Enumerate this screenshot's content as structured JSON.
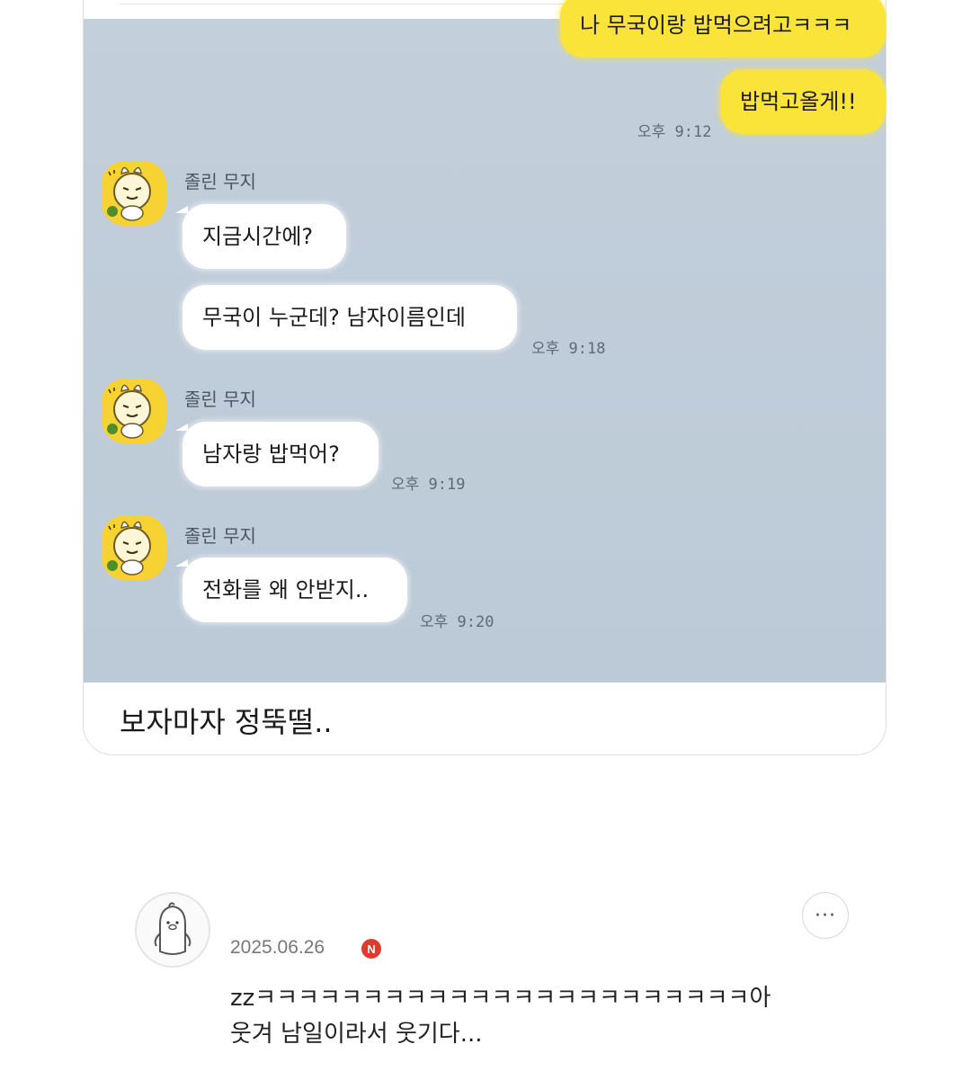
{
  "chat": {
    "messages_me": [
      {
        "text": "나 무국이랑 밥먹으려고ㅋㅋㅋ"
      },
      {
        "text": "밥먹고올게!!",
        "time": "오후 9:12"
      }
    ],
    "groups": [
      {
        "sender": "졸린 무지",
        "messages": [
          {
            "text": "지금시간에?"
          },
          {
            "text": "무국이 누군데? 남자이름인데",
            "time": "오후 9:18"
          }
        ]
      },
      {
        "sender": "졸린 무지",
        "messages": [
          {
            "text": "남자랑 밥먹어?",
            "time": "오후 9:19"
          }
        ]
      },
      {
        "sender": "졸린 무지",
        "messages": [
          {
            "text": "전화를 왜 안받지..",
            "time": "오후 9:20"
          }
        ]
      }
    ]
  },
  "caption": "보자마자 정뚝떨..",
  "comment": {
    "date": "2025.06.26",
    "badge": "N",
    "more": "···",
    "line1": "zzㅋㅋㅋㅋㅋㅋㅋㅋㅋㅋㅋㅋㅋㅋㅋㅋㅋㅋㅋㅋㅋㅋㅋ아",
    "line2": "웃겨  남일이라서 웃기다..."
  },
  "colors": {
    "chat_background": "#bfcedb",
    "my_bubble": "#fbe43a",
    "other_bubble": "#ffffff",
    "avatar_bg": "#f7d233",
    "new_badge": "#e03a2f"
  },
  "icons": {
    "chat_avatar": "muzi-character-icon",
    "comment_avatar": "penguin-profile-icon",
    "more": "more-options-icon"
  }
}
